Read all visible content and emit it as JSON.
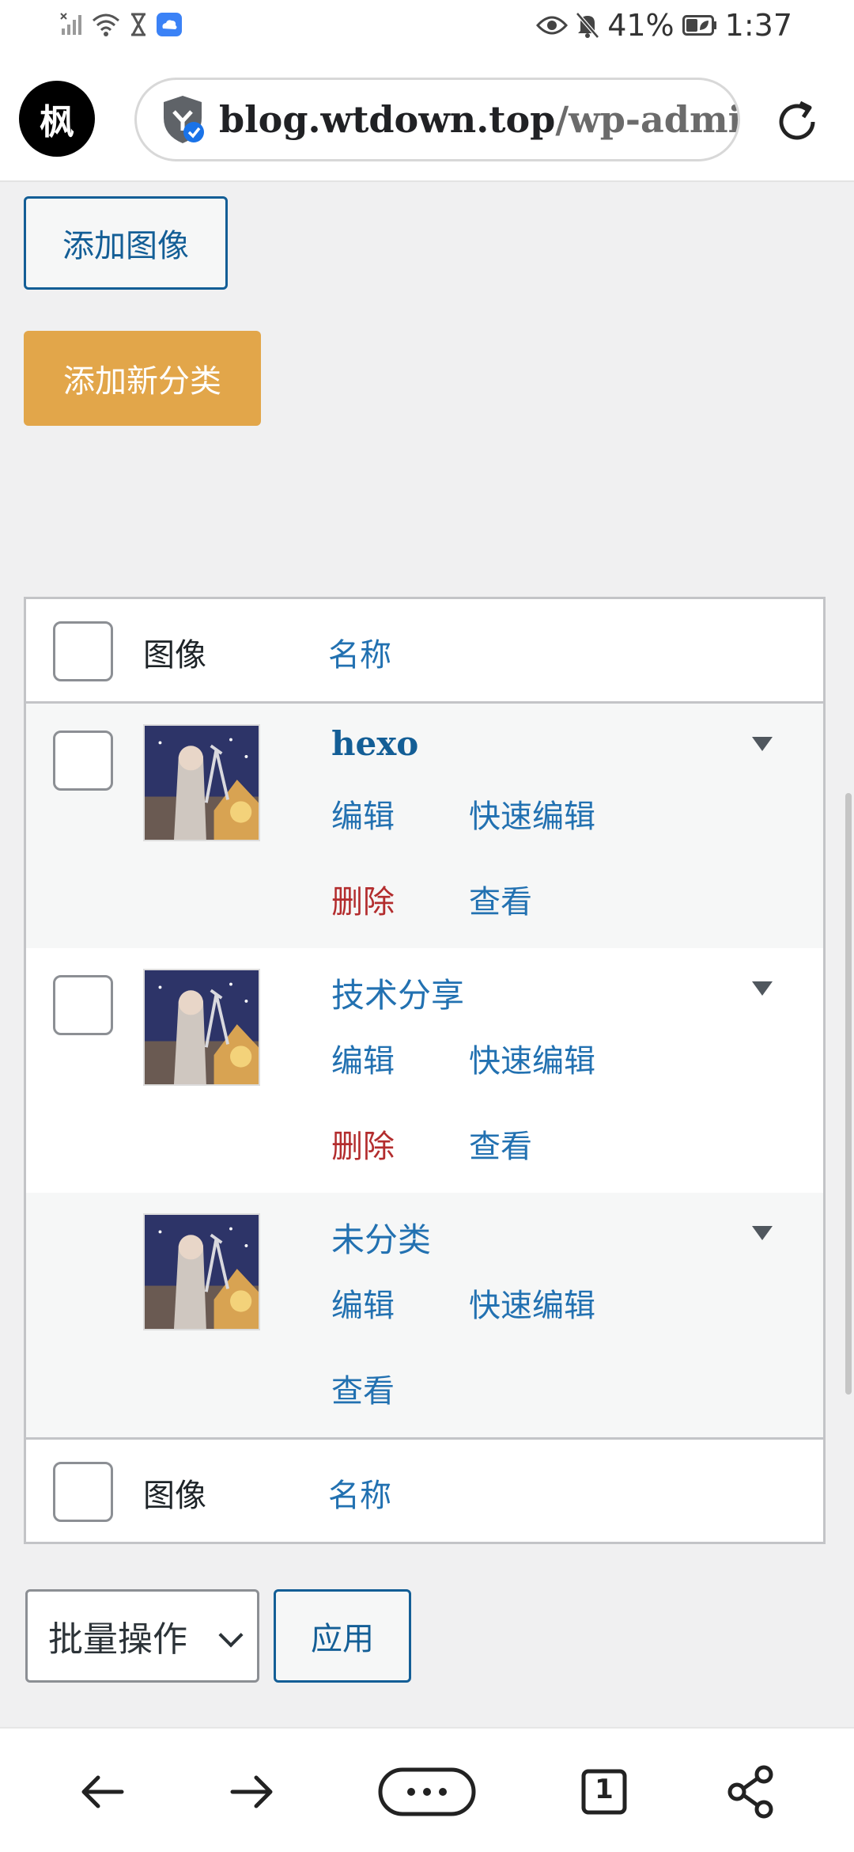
{
  "status_bar": {
    "battery_percent": "41%",
    "time": "1:37",
    "icons": [
      "signal-off-icon",
      "wifi-icon",
      "hourglass-icon",
      "cloud-app-icon",
      "eye-icon",
      "mute-bell-icon",
      "battery-saver-icon"
    ]
  },
  "browser": {
    "site_logo": "枫",
    "url_host": "blog.wtdown.top",
    "url_path": "/wp-admin/",
    "icons": [
      "shield-icon",
      "reload-icon"
    ]
  },
  "form": {
    "add_image_label": "添加图像",
    "add_category_label": "添加新分类"
  },
  "table": {
    "header": {
      "image": "图像",
      "name": "名称"
    },
    "footer": {
      "image": "图像",
      "name": "名称"
    },
    "rows": [
      {
        "name": "hexo",
        "actions": [
          "编辑",
          "快速编辑",
          "删除",
          "查看"
        ]
      },
      {
        "name": "技术分享",
        "actions": [
          "编辑",
          "快速编辑",
          "删除",
          "查看"
        ]
      },
      {
        "name": "未分类",
        "actions": [
          "编辑",
          "快速编辑",
          "查看"
        ]
      }
    ]
  },
  "bulk": {
    "select_value": "批量操作",
    "apply_label": "应用"
  },
  "nav": {
    "tab_count": "1",
    "icons": [
      "back-arrow-icon",
      "forward-arrow-icon",
      "more-menu-icon",
      "tabs-icon",
      "share-icon"
    ]
  },
  "colors": {
    "link": "#2271b1",
    "delete": "#b32d2e",
    "primary_button": "#e2a64a"
  }
}
